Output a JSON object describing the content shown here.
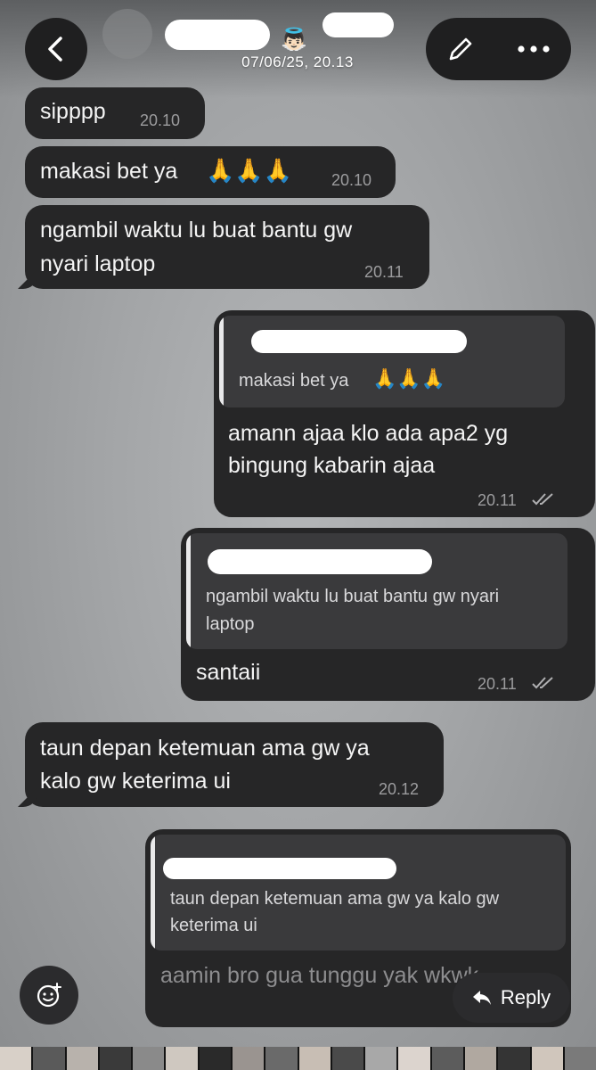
{
  "header": {
    "timestamp": "07/06/25, 20.13",
    "angel_emoji": "👼🏻"
  },
  "messages": [
    {
      "direction": "in",
      "text": "sipppp",
      "time": "20.10"
    },
    {
      "direction": "in",
      "text": "makasi bet ya",
      "emoji": "🙏🙏🙏",
      "time": "20.10"
    },
    {
      "direction": "in",
      "lines": [
        "ngambil waktu lu buat bantu gw",
        "nyari laptop"
      ],
      "time": "20.11"
    },
    {
      "direction": "out",
      "quote": {
        "text": "makasi bet ya",
        "emoji": "🙏🙏🙏"
      },
      "lines": [
        "amann ajaa klo ada apa2 yg",
        "bingung kabarin ajaa"
      ],
      "time": "20.11"
    },
    {
      "direction": "out",
      "quote": {
        "lines": [
          "ngambil waktu lu buat bantu gw nyari",
          "laptop"
        ]
      },
      "text": "santaii",
      "time": "20.11"
    },
    {
      "direction": "in",
      "lines": [
        "taun depan ketemuan ama gw ya",
        "kalo gw keterima ui"
      ],
      "time": "20.12"
    },
    {
      "direction": "out",
      "quote": {
        "lines": [
          "taun depan ketemuan ama gw ya kalo gw",
          "keterima ui"
        ]
      },
      "text": "aamin bro gua tunggu yak wkwk"
    }
  ],
  "footer": {
    "reply_label": "Reply",
    "reply_icon": "reply-arrow-icon",
    "sticker_icon": "sticker-add-icon"
  },
  "colors": {
    "bubble": "#262627",
    "quote": "#3a3a3c",
    "background": "#a3a5a7"
  }
}
